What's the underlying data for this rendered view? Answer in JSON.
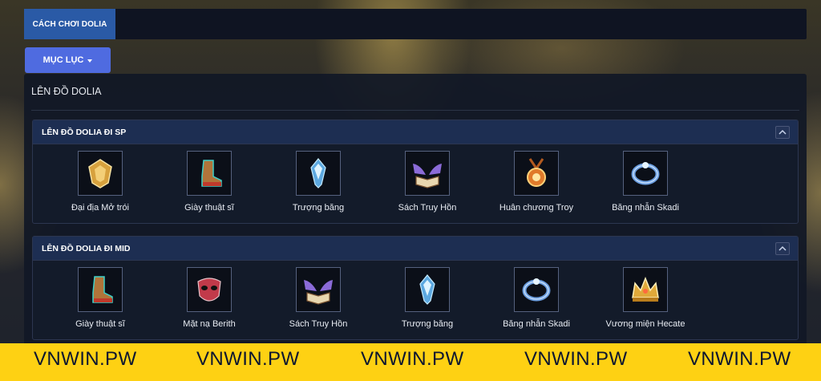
{
  "header": {
    "tab_label": "CÁCH CHƠI DOLIA"
  },
  "menu_button": {
    "label": "MỤC LỤC"
  },
  "main": {
    "title": "LÊN ĐỒ DOLIA",
    "sections": [
      {
        "title": "LÊN ĐỒ DOLIA ĐI SP",
        "items": [
          {
            "label": "Đại địa Mở trói",
            "icon": "golden-shield-icon",
            "color": "#d7a13d"
          },
          {
            "label": "Giày thuật sĩ",
            "icon": "boot-icon",
            "color": "#b0743a"
          },
          {
            "label": "Trượng băng",
            "icon": "ice-staff-icon",
            "color": "#5ca8e0"
          },
          {
            "label": "Sách Truy Hồn",
            "icon": "winged-book-icon",
            "color": "#8b6bd8"
          },
          {
            "label": "Huân chương Troy",
            "icon": "medal-icon",
            "color": "#e07a2a"
          },
          {
            "label": "Băng nhẫn Skadi",
            "icon": "ice-ring-icon",
            "color": "#6d9fe0"
          }
        ]
      },
      {
        "title": "LÊN ĐỒ DOLIA ĐI MID",
        "items": [
          {
            "label": "Giày thuật sĩ",
            "icon": "boot-icon",
            "color": "#b0743a"
          },
          {
            "label": "Mặt nạ Berith",
            "icon": "mask-icon",
            "color": "#c23a4a"
          },
          {
            "label": "Sách Truy Hồn",
            "icon": "winged-book-icon",
            "color": "#8b6bd8"
          },
          {
            "label": "Trượng băng",
            "icon": "ice-staff-icon",
            "color": "#5ca8e0"
          },
          {
            "label": "Băng nhẫn Skadi",
            "icon": "ice-ring-icon",
            "color": "#6d9fe0"
          },
          {
            "label": "Vương miện Hecate",
            "icon": "crown-icon",
            "color": "#e0a93a"
          }
        ]
      }
    ]
  },
  "footer": {
    "watermarks": [
      "VNWIN.PW",
      "VNWIN.PW",
      "VNWIN.PW",
      "VNWIN.PW",
      "VNWIN.PW"
    ]
  },
  "colors": {
    "tab_bg": "#2a5aa6",
    "menu_button_bg": "#4f6be0",
    "section_header_bg": "#1d2e52",
    "footer_bg": "#fed113"
  }
}
